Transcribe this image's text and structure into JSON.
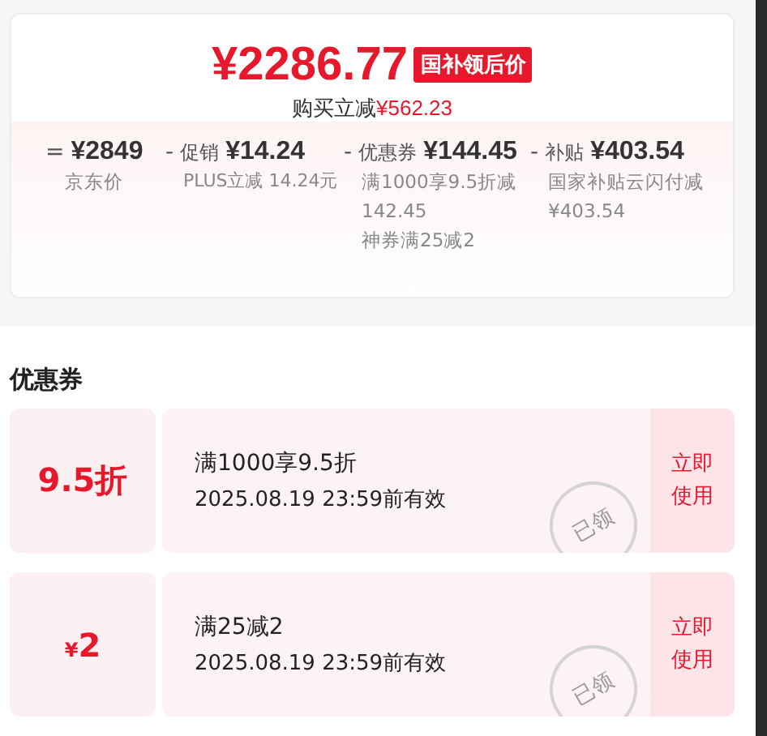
{
  "price": {
    "amount": "¥2286.77",
    "tag": "国补领后价",
    "saving_label": "购买立减",
    "saving": "¥562.23"
  },
  "breakdown": [
    {
      "op": "=",
      "amount": "¥2849",
      "notes": [
        "京东价"
      ]
    },
    {
      "op": "-",
      "label": "促销",
      "amount": "¥14.24",
      "notes": [
        "PLUS立减 14.24元"
      ]
    },
    {
      "op": "-",
      "label": "优惠券",
      "amount": "¥144.45",
      "notes": [
        "满1000享9.5折减142.45",
        "神券满25减2"
      ]
    },
    {
      "op": "-",
      "label": "补贴",
      "amount": "¥403.54",
      "notes": [
        "国家补贴云闪付减¥403.54"
      ]
    }
  ],
  "coupons_title": "优惠券",
  "coupons": [
    {
      "amount": "9.5折",
      "title": "满1000享9.5折",
      "expiry": "2025.08.19 23:59前有效",
      "stamp": "已领",
      "action": "立即使用"
    },
    {
      "currency": "¥",
      "amount": "2",
      "title": "满25减2",
      "expiry": "2025.08.19 23:59前有效",
      "stamp": "已领",
      "action": "立即使用"
    }
  ]
}
